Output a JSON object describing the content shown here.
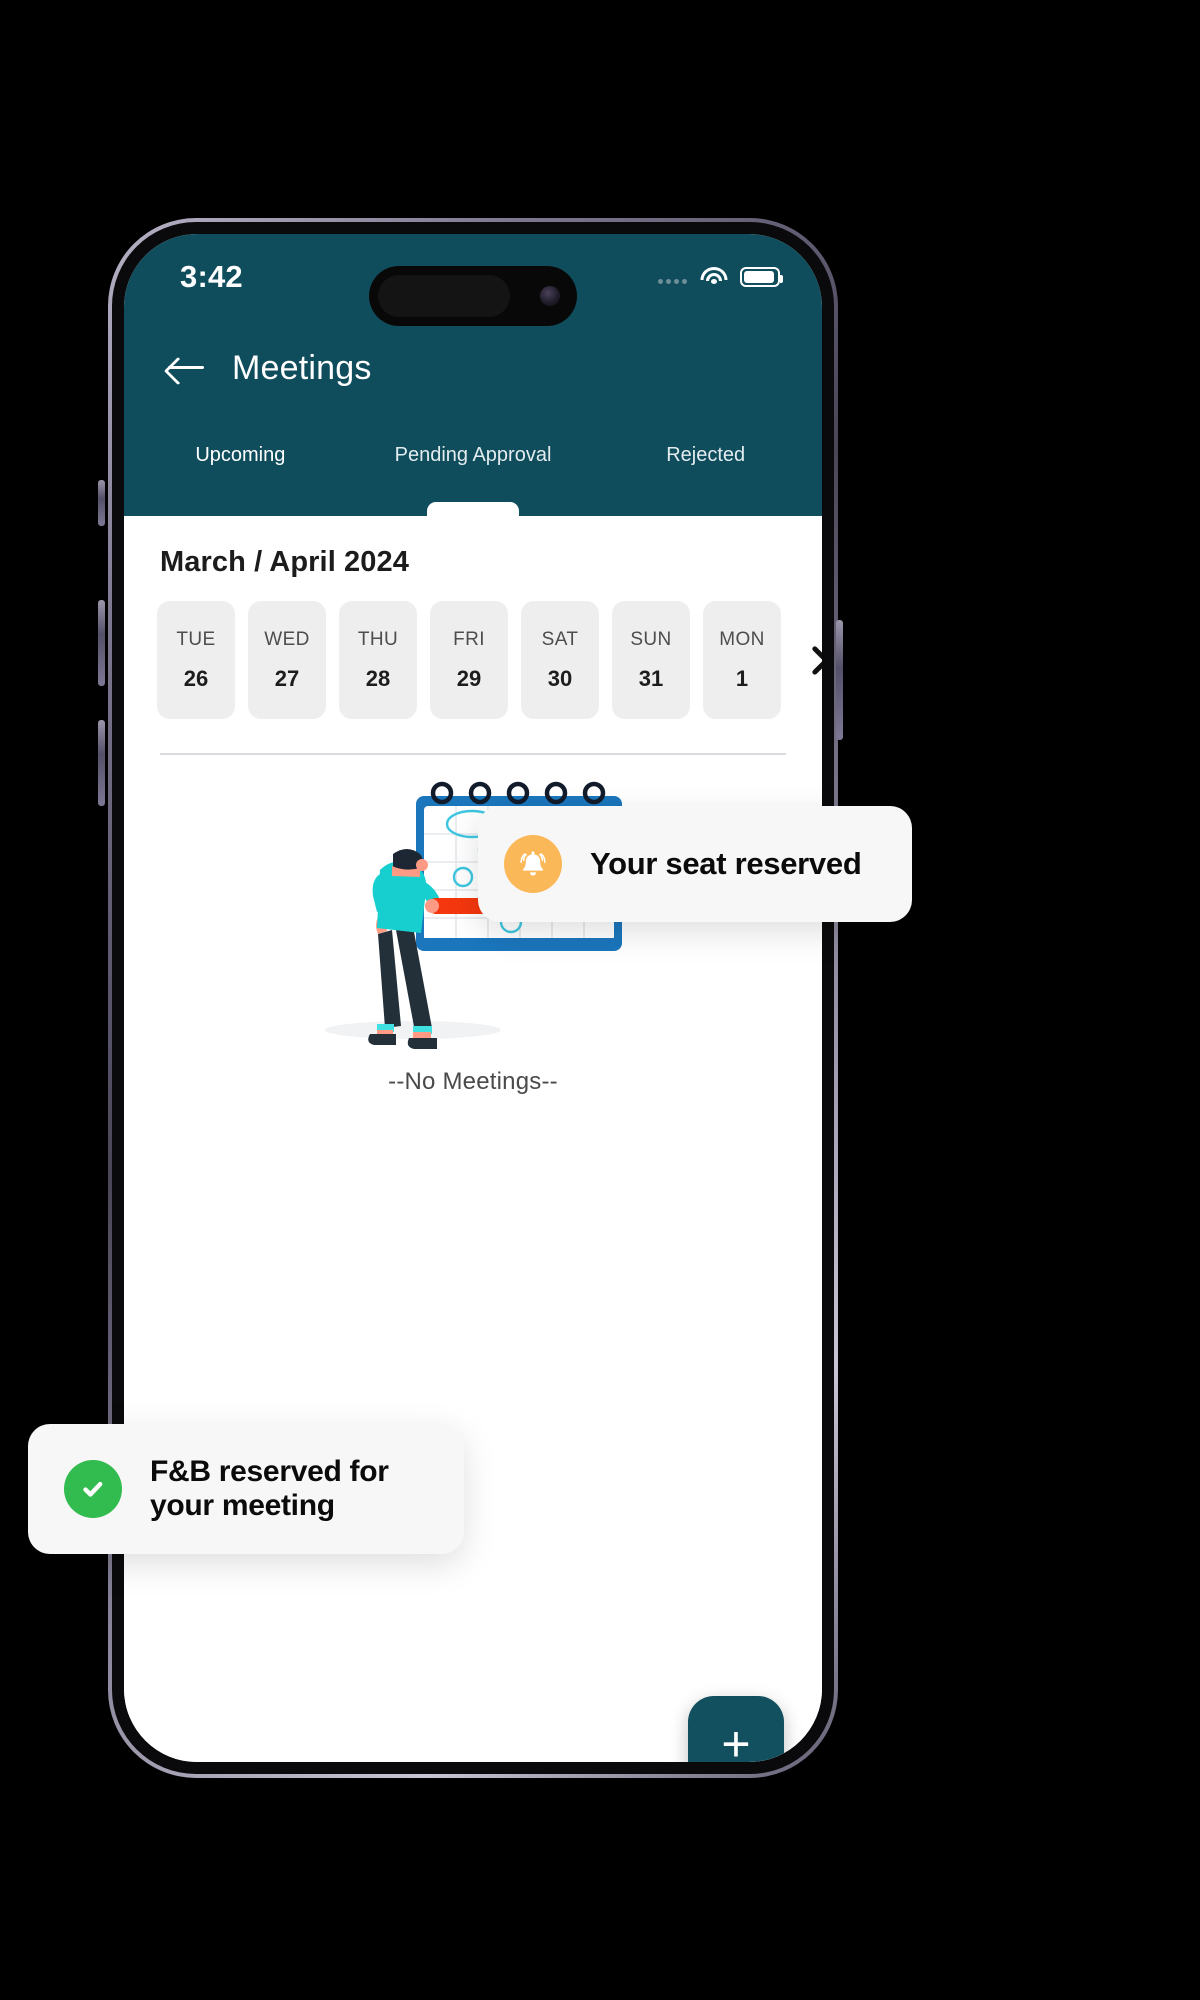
{
  "statusbar": {
    "time": "3:42",
    "signal_icon": "signal-dots-icon",
    "wifi_icon": "wifi-icon",
    "battery_icon": "battery-icon"
  },
  "appbar": {
    "back_icon": "back-arrow-icon",
    "title": "Meetings",
    "background_color": "#0f4c5c"
  },
  "tabs": [
    {
      "label": "Upcoming",
      "active": true
    },
    {
      "label": "Pending Approval",
      "active": false
    },
    {
      "label": "Rejected",
      "active": false
    }
  ],
  "calendar": {
    "month_label": "March / April 2024",
    "next_icon": "chevron-right-icon",
    "days": [
      {
        "day": "TUE",
        "date": "26"
      },
      {
        "day": "WED",
        "date": "27"
      },
      {
        "day": "THU",
        "date": "28"
      },
      {
        "day": "FRI",
        "date": "29"
      },
      {
        "day": "SAT",
        "date": "30"
      },
      {
        "day": "SUN",
        "date": "31"
      },
      {
        "day": "MON",
        "date": "1"
      }
    ]
  },
  "empty_state": {
    "illustration": "calendar-planning-illustration",
    "message": "--No Meetings--"
  },
  "fab": {
    "label": "+",
    "icon": "plus-icon",
    "color": "#12505f"
  },
  "toasts": [
    {
      "id": "seat",
      "icon": "bell-icon",
      "icon_color": "#fbb858",
      "text": "Your seat reserved"
    },
    {
      "id": "fnb",
      "icon": "check-circle-icon",
      "icon_color": "#32bb4f",
      "text_line1": "F&B reserved for",
      "text_line2": "your meeting"
    }
  ]
}
